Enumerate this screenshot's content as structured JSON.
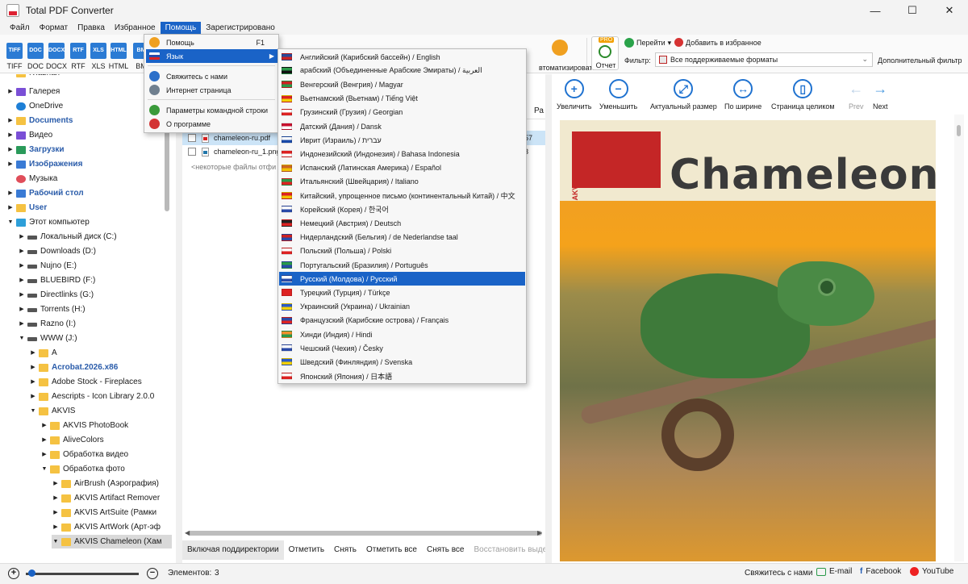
{
  "window": {
    "title": "Total PDF Converter",
    "minimize": "—",
    "maximize": "☐",
    "close": "✕"
  },
  "menubar": [
    "Файл",
    "Формат",
    "Правка",
    "Избранное",
    "Помощь",
    "Зарегистрировано"
  ],
  "toolbar": {
    "formats": [
      "TIFF",
      "DOC",
      "DOCX",
      "RTF",
      "XLS",
      "HTML",
      "BM"
    ],
    "automate_label": "втоматизировать",
    "report_pro": "PRO",
    "report_label": "Отчет",
    "goto_label": "Перейти",
    "favorite_label": "Добавить в избранное",
    "filter_label": "Фильтр:",
    "filter_value": "Все поддерживаемые форматы",
    "extra_filter": "Дополнительный фильтр"
  },
  "help_menu": {
    "items": [
      {
        "label": "Помощь",
        "shortcut": "F1",
        "icon": "help-icon",
        "color": "#f0a020"
      },
      {
        "label": "Язык",
        "icon": "flag-icon",
        "active": true
      },
      {
        "label": "Свяжитесь с нами",
        "icon": "mail-icon",
        "color": "#2b6fc9"
      },
      {
        "label": "Интернет страница",
        "icon": "globe-icon",
        "color": "#6f7f8f"
      },
      {
        "label": "Параметры командной строки",
        "icon": "cmd-icon",
        "color": "#3a9a3a"
      },
      {
        "label": "О программе",
        "icon": "info-icon",
        "color": "#d33333"
      }
    ]
  },
  "languages": [
    {
      "label": "Английский (Карибский бассейн) / English",
      "c1": "#2a4a9a",
      "c2": "#c22"
    },
    {
      "label": "арабский (Объединенные Арабские Эмираты) / العربية",
      "c1": "#2a9a4a",
      "c2": "#111"
    },
    {
      "label": "Венгерский (Венгрия) / Magyar",
      "c1": "#c22",
      "c2": "#2a9a4a"
    },
    {
      "label": "Вьетнамский (Вьетнам) / Tiếng Việt",
      "c1": "#d22",
      "c2": "#f2d000"
    },
    {
      "label": "Грузинский (Грузия) / Georgian",
      "c1": "#fff",
      "c2": "#d22"
    },
    {
      "label": "Датский (Дания) / Dansk",
      "c1": "#c8102e",
      "c2": "#fff"
    },
    {
      "label": "Иврит (Израиль) / עברית",
      "c1": "#fff",
      "c2": "#1a4aa8"
    },
    {
      "label": "Индонезийский (Индонезия) / Bahasa Indonesia",
      "c1": "#d22",
      "c2": "#fff"
    },
    {
      "label": "Испанский (Латинская Америка) / Español",
      "c1": "#c62",
      "c2": "#f2c200"
    },
    {
      "label": "Итальянский (Швейцария) / Italiano",
      "c1": "#2a9a4a",
      "c2": "#d22"
    },
    {
      "label": "Китайский, упрощенное письмо (континентальный Китай) / 中文",
      "c1": "#d22",
      "c2": "#f2c200"
    },
    {
      "label": "Корейский (Корея) / 한국어",
      "c1": "#fff",
      "c2": "#2a4aa8"
    },
    {
      "label": "Немецкий (Австрия) / Deutsch",
      "c1": "#222",
      "c2": "#d22"
    },
    {
      "label": "Нидерландский (Бельгия) / de Nederlandse taal",
      "c1": "#c22",
      "c2": "#2a4aa8"
    },
    {
      "label": "Польский (Польша) / Polski",
      "c1": "#fff",
      "c2": "#d22"
    },
    {
      "label": "Португальский (Бразилия) / Português",
      "c1": "#2a9a4a",
      "c2": "#2a4aa8"
    },
    {
      "label": "Русский (Молдова) / Русский",
      "c1": "#fff",
      "c2": "#2a4aa8",
      "active": true
    },
    {
      "label": "Турецкий (Турция) / Türkçe",
      "c1": "#d22",
      "c2": "#d22"
    },
    {
      "label": "Украинский (Украина) / Ukrainian",
      "c1": "#2a5ac8",
      "c2": "#f2d000"
    },
    {
      "label": "Французский (Карибские острова) / Français",
      "c1": "#2a4aa8",
      "c2": "#d22"
    },
    {
      "label": "Хинди (Индия) / Hindi",
      "c1": "#f0902a",
      "c2": "#2a9a4a"
    },
    {
      "label": "Чешский (Чехия) / Česky",
      "c1": "#fff",
      "c2": "#2a4aa8"
    },
    {
      "label": "Шведский (Финляндия) / Svenska",
      "c1": "#2a5ac8",
      "c2": "#f2d000"
    },
    {
      "label": "Японский (Япония) / 日本語",
      "c1": "#fff",
      "c2": "#d22"
    }
  ],
  "tree": [
    {
      "label": "Главная",
      "indent": 0,
      "arrow": "",
      "icon": "ti-folder",
      "bold": false,
      "partial": true
    },
    {
      "label": "Галерея",
      "indent": 0,
      "arrow": "▶",
      "icon": "ti-purple",
      "bold": false
    },
    {
      "label": "OneDrive",
      "indent": 0,
      "arrow": "",
      "icon": "ti-cloud",
      "bold": false
    },
    {
      "label": "Documents",
      "indent": 0,
      "arrow": "▶",
      "icon": "ti-folder",
      "bold": true
    },
    {
      "label": "Видео",
      "indent": 0,
      "arrow": "▶",
      "icon": "ti-purple",
      "bold": false
    },
    {
      "label": "Загрузки",
      "indent": 0,
      "arrow": "▶",
      "icon": "ti-green",
      "bold": true
    },
    {
      "label": "Изображения",
      "indent": 0,
      "arrow": "▶",
      "icon": "ti-blue",
      "bold": true
    },
    {
      "label": "Музыка",
      "indent": 0,
      "arrow": "",
      "icon": "ti-music",
      "bold": false
    },
    {
      "label": "Рабочий стол",
      "indent": 0,
      "arrow": "▶",
      "icon": "ti-blue",
      "bold": true
    },
    {
      "label": "User",
      "indent": 0,
      "arrow": "▶",
      "icon": "ti-folder",
      "bold": true
    },
    {
      "label": "Этот компьютер",
      "indent": 0,
      "arrow": "▼",
      "icon": "ti-pc",
      "bold": false
    },
    {
      "label": "Локальный диск (C:)",
      "indent": 1,
      "arrow": "▶",
      "icon": "ti-drive",
      "bold": false
    },
    {
      "label": "Downloads (D:)",
      "indent": 1,
      "arrow": "▶",
      "icon": "ti-drive",
      "bold": false
    },
    {
      "label": "Nujno (E:)",
      "indent": 1,
      "arrow": "▶",
      "icon": "ti-drive",
      "bold": false
    },
    {
      "label": "BLUEBIRD (F:)",
      "indent": 1,
      "arrow": "▶",
      "icon": "ti-drive",
      "bold": false
    },
    {
      "label": "Directlinks (G:)",
      "indent": 1,
      "arrow": "▶",
      "icon": "ti-drive",
      "bold": false
    },
    {
      "label": "Torrents (H:)",
      "indent": 1,
      "arrow": "▶",
      "icon": "ti-drive",
      "bold": false
    },
    {
      "label": "Razno (I:)",
      "indent": 1,
      "arrow": "▶",
      "icon": "ti-drive",
      "bold": false
    },
    {
      "label": "WWW (J:)",
      "indent": 1,
      "arrow": "▼",
      "icon": "ti-drive",
      "bold": false
    },
    {
      "label": "A",
      "indent": 2,
      "arrow": "▶",
      "icon": "ti-folder",
      "bold": false
    },
    {
      "label": "Acrobat.2026.x86",
      "indent": 2,
      "arrow": "▶",
      "icon": "ti-folder",
      "bold": true
    },
    {
      "label": "Adobe Stock - Fireplaces",
      "indent": 2,
      "arrow": "▶",
      "icon": "ti-folder",
      "bold": false
    },
    {
      "label": "Aescripts - Icon Library 2.0.0",
      "indent": 2,
      "arrow": "▶",
      "icon": "ti-folder",
      "bold": false
    },
    {
      "label": "AKVIS",
      "indent": 2,
      "arrow": "▼",
      "icon": "ti-folder",
      "bold": false
    },
    {
      "label": "AKVIS PhotoBook",
      "indent": 3,
      "arrow": "▶",
      "icon": "ti-folder",
      "bold": false
    },
    {
      "label": "AliveColors",
      "indent": 3,
      "arrow": "▶",
      "icon": "ti-folder",
      "bold": false
    },
    {
      "label": "Обработка видео",
      "indent": 3,
      "arrow": "▶",
      "icon": "ti-folder",
      "bold": false
    },
    {
      "label": "Обработка фото",
      "indent": 3,
      "arrow": "▼",
      "icon": "ti-folder",
      "bold": false
    },
    {
      "label": "AirBrush (Аэрография)",
      "indent": 4,
      "arrow": "▶",
      "icon": "ti-folder",
      "bold": false
    },
    {
      "label": "AKVIS Artifact Remover",
      "indent": 4,
      "arrow": "▶",
      "icon": "ti-folder",
      "bold": false
    },
    {
      "label": "AKVIS ArtSuite (Рамки",
      "indent": 4,
      "arrow": "▶",
      "icon": "ti-folder",
      "bold": false
    },
    {
      "label": "AKVIS ArtWork (Арт-эф",
      "indent": 4,
      "arrow": "▶",
      "icon": "ti-folder",
      "bold": false
    },
    {
      "label": "AKVIS Chameleon (Хам",
      "indent": 4,
      "arrow": "▼",
      "icon": "ti-folder",
      "bold": false,
      "selected": true
    }
  ],
  "filelist": {
    "col_partial": "Ра",
    "files": [
      {
        "name": "chameleon-ru.pdf",
        "type": "pdf",
        "num": "57",
        "highlight": true
      },
      {
        "name": "chameleon-ru_1.png",
        "type": "png",
        "num": "3",
        "highlight": false
      }
    ],
    "note": "<некоторые файлы отфи"
  },
  "file_actions": [
    "Включая поддиректории",
    "Отметить",
    "Снять",
    "Отметить все",
    "Снять все",
    "Восстановить выде"
  ],
  "preview_toolbar": [
    {
      "label": "Увеличить",
      "glyph": "+"
    },
    {
      "label": "Уменьшить",
      "glyph": "−"
    },
    {
      "label": "Актуальный размер",
      "glyph": "⤢"
    },
    {
      "label": "По ширине",
      "glyph": "↔"
    },
    {
      "label": "Страница целиком",
      "glyph": "▯"
    },
    {
      "label": "Prev",
      "glyph": "←",
      "dim": true
    },
    {
      "label": "Next",
      "glyph": "→",
      "dim": false
    }
  ],
  "preview": {
    "brand": "Chameleon",
    "logo": "AKVIS"
  },
  "statusbar": {
    "zoom_in": "+",
    "zoom_out": "−",
    "zoom_level": 0.02,
    "items_label": "Элементов:",
    "items_count": "3",
    "contact": "Свяжитесь с нами",
    "email": "E-mail",
    "facebook": "Facebook",
    "youtube": "YouTube"
  }
}
